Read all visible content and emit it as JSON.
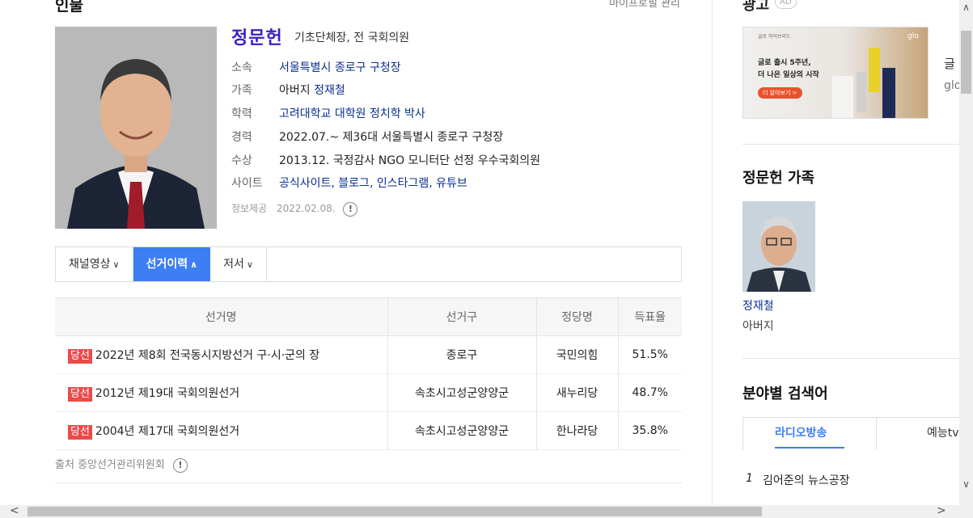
{
  "header": {
    "title": "인물",
    "manage_link": "마이프로필 관리"
  },
  "profile": {
    "name": "정문헌",
    "subtitle": "기초단체장, 전 국회의원",
    "rows": [
      {
        "key": "소속",
        "value": "서울특별시 종로구 구청장",
        "link": true
      },
      {
        "key": "가족",
        "value_prefix": "아버지 ",
        "value": "정재철",
        "link": true
      },
      {
        "key": "학력",
        "value": "고려대학교 대학원 정치학 박사",
        "link": true
      },
      {
        "key": "경력",
        "value": "2022.07.~ 제36대 서울특별시 종로구 구청장",
        "link": false
      },
      {
        "key": "수상",
        "value": "2013.12. 국정감사 NGO 모니터단 선정 우수국회의원",
        "link": false
      },
      {
        "key": "사이트",
        "value": "공식사이트, 블로그, 인스타그램, 유튜브",
        "link": true
      }
    ],
    "source_label": "정보제공",
    "source_date": "2022.02.08.",
    "info_icon": "!"
  },
  "tabs": [
    {
      "label": "채널영상",
      "chevron": "∨"
    },
    {
      "label": "선거이력",
      "chevron": "∧"
    },
    {
      "label": "저서",
      "chevron": "∨"
    }
  ],
  "elections": {
    "headers": [
      "선거명",
      "선거구",
      "정당명",
      "득표율"
    ],
    "rows": [
      {
        "badge": "당선",
        "name": "2022년 제8회 전국동시지방선거 구·시·군의 장",
        "district": "종로구",
        "party": "국민의힘",
        "rate": "51.5%"
      },
      {
        "badge": "당선",
        "name": "2012년 제19대 국회의원선거",
        "district": "속초시고성군양양군",
        "party": "새누리당",
        "rate": "48.7%"
      },
      {
        "badge": "당선",
        "name": "2004년 제17대 국회의원선거",
        "district": "속초시고성군양양군",
        "party": "한나라당",
        "rate": "35.8%"
      }
    ],
    "source": "출처 중앙선거관리위원회"
  },
  "ad": {
    "title": "광고",
    "badge": "AD",
    "small_text": "글로 하이브리드",
    "logo": "glo",
    "line1": "글로 출시 5주년,",
    "line2": "더 나은 일상의 시작",
    "cta": "더 알아보기 >",
    "side1": "글",
    "side2": "glo"
  },
  "family": {
    "title": "정문헌 가족",
    "name": "정재철",
    "relation": "아버지"
  },
  "keywords": {
    "title": "분야별 검색어",
    "tab1": "라디오방송",
    "tab2": "예능tv",
    "item_num": "1",
    "item": "김어준의 뉴스공장"
  },
  "scroll": {
    "up": "∧",
    "down": "∨",
    "left": "<",
    "right": ">"
  }
}
